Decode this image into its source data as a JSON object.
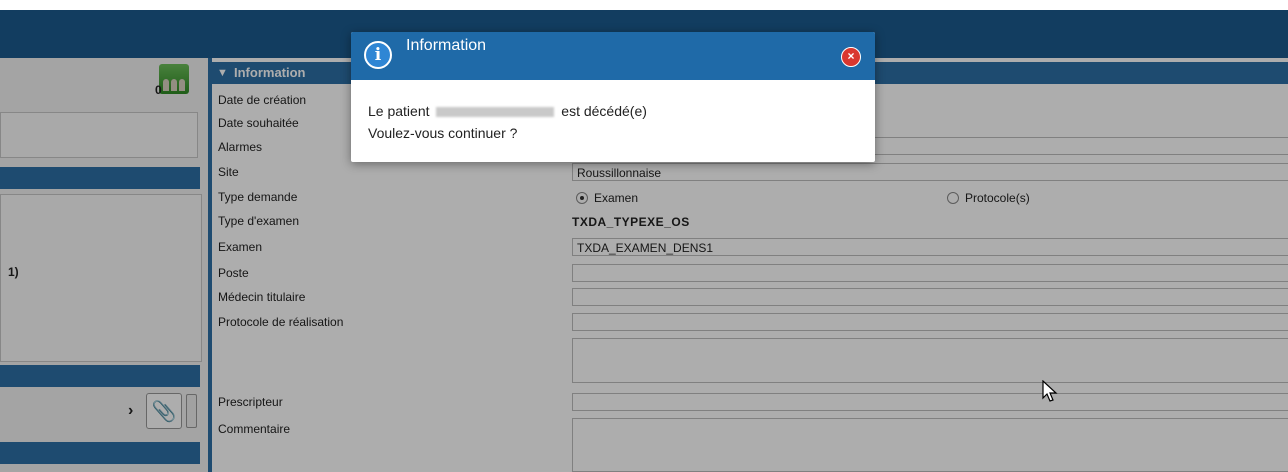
{
  "left_panel": {
    "group_count": "0",
    "row_marker": "1)"
  },
  "section": {
    "title": "Information"
  },
  "form": {
    "labels": {
      "date_creation": "Date de création",
      "date_souhaitee": "Date souhaitée",
      "alarmes": "Alarmes",
      "site": "Site",
      "type_demande": "Type demande",
      "type_examen": "Type d'examen",
      "examen": "Examen",
      "poste": "Poste",
      "medecin_titulaire": "Médecin titulaire",
      "protocole_realisation": "Protocole de réalisation",
      "prescripteur": "Prescripteur",
      "commentaire": "Commentaire"
    },
    "site_value": "Roussillonnaise",
    "type_demande_options": {
      "examen": "Examen",
      "protocole": "Protocole(s)"
    },
    "type_examen_value": "TXDA_TYPEXE_OS",
    "examen_value": "TXDA_EXAMEN_DENS1"
  },
  "dialog": {
    "title": "Information",
    "message_prefix": "Le patient",
    "message_suffix": "est décédé(e)",
    "message_line2": "Voulez-vous continuer ?",
    "close_label": "×"
  }
}
